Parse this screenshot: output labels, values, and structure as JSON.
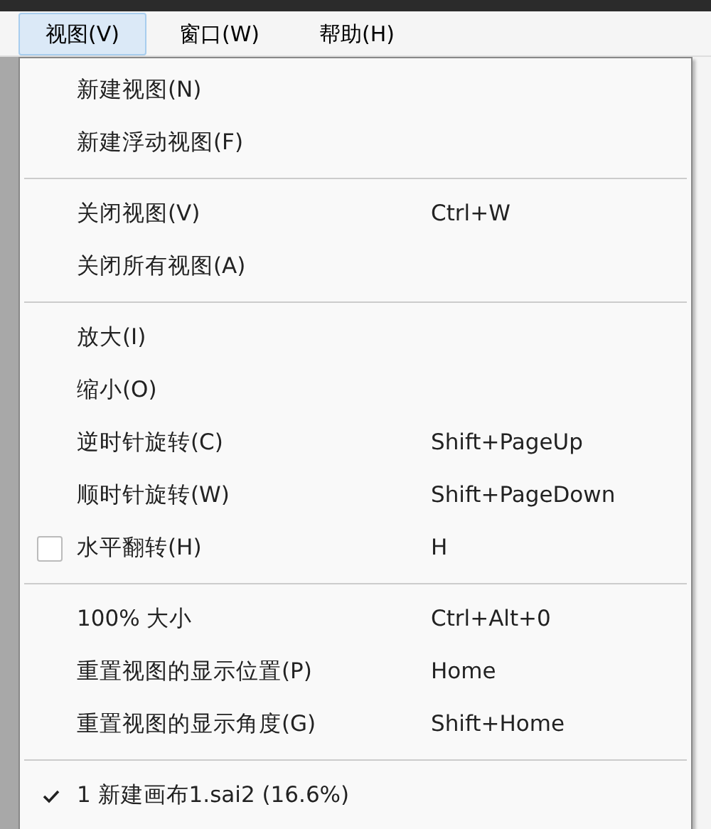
{
  "menubar": [
    {
      "label": "视图(V)",
      "selected": true
    },
    {
      "label": "窗口(W)",
      "selected": false
    },
    {
      "label": "帮助(H)",
      "selected": false
    }
  ],
  "menu": {
    "sections": [
      {
        "items": [
          {
            "kind": "command",
            "label": "新建视图(N)"
          },
          {
            "kind": "command",
            "label": "新建浮动视图(F)"
          }
        ]
      },
      {
        "items": [
          {
            "kind": "command",
            "label": "关闭视图(V)",
            "shortcut": "Ctrl+W"
          },
          {
            "kind": "command",
            "label": "关闭所有视图(A)"
          }
        ]
      },
      {
        "items": [
          {
            "kind": "command",
            "label": "放大(I)"
          },
          {
            "kind": "command",
            "label": "缩小(O)"
          },
          {
            "kind": "command",
            "label": "逆时针旋转(C)",
            "shortcut": "Shift+PageUp"
          },
          {
            "kind": "command",
            "label": "顺时针旋转(W)",
            "shortcut": "Shift+PageDown"
          },
          {
            "kind": "checkbox",
            "label": "水平翻转(H)",
            "shortcut": "H",
            "checked": false
          }
        ]
      },
      {
        "items": [
          {
            "kind": "command",
            "label": "100% 大小",
            "shortcut": "Ctrl+Alt+0"
          },
          {
            "kind": "command",
            "label": "重置视图的显示位置(P)",
            "shortcut": "Home"
          },
          {
            "kind": "command",
            "label": "重置视图的显示角度(G)",
            "shortcut": "Shift+Home"
          }
        ]
      },
      {
        "items": [
          {
            "kind": "window",
            "label": "1 新建画布1.sai2 (16.6%)",
            "checked": true
          }
        ]
      }
    ]
  }
}
